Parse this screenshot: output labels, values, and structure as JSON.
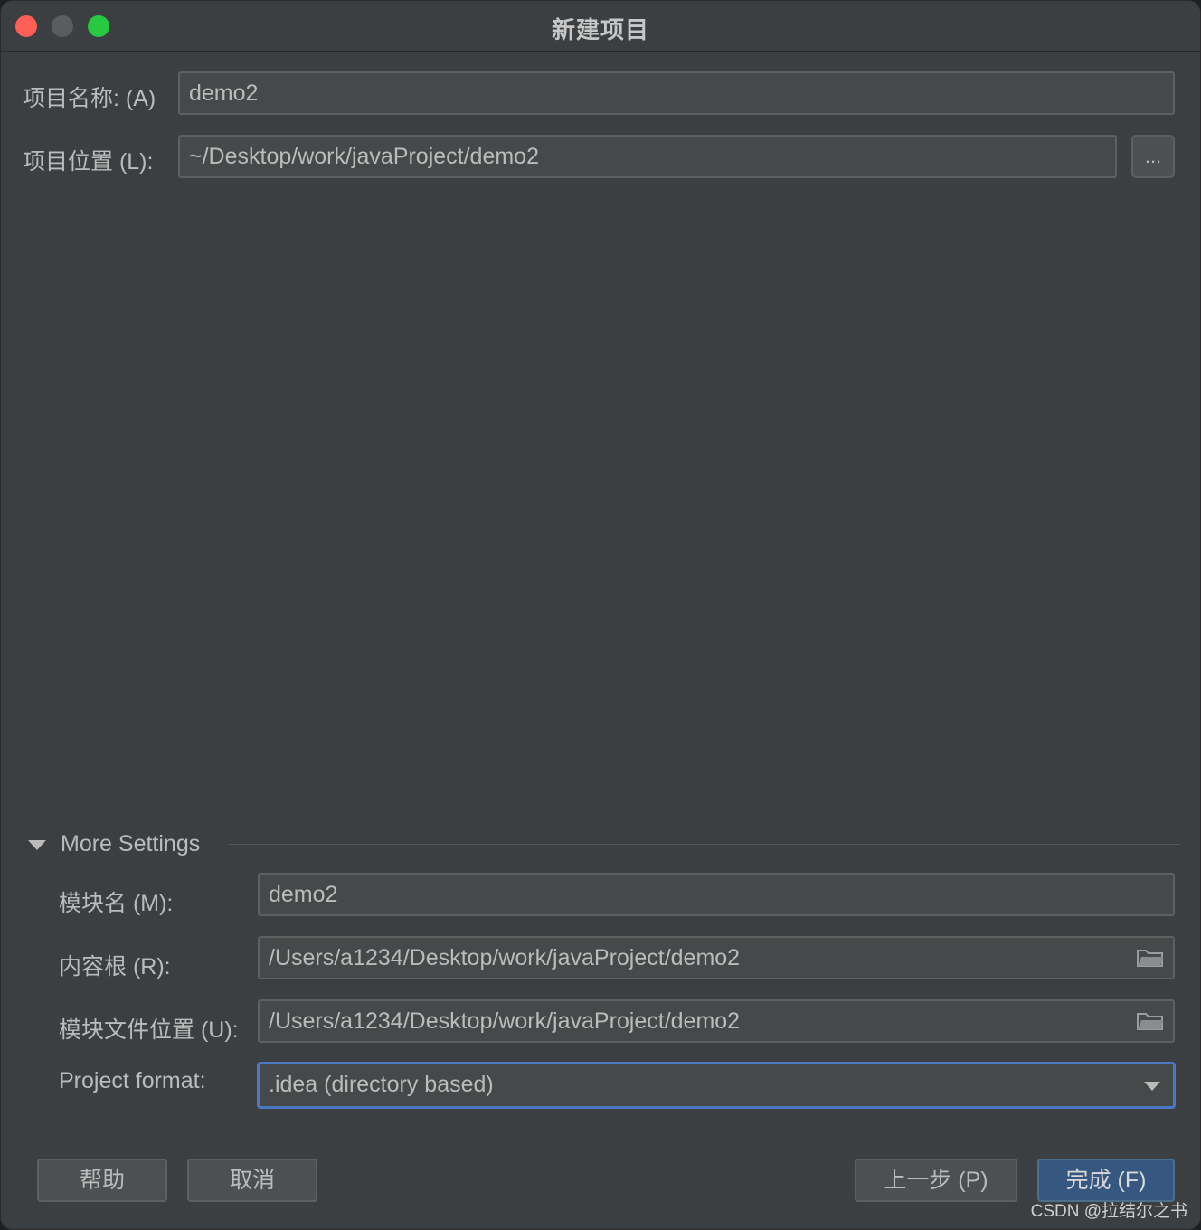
{
  "window": {
    "title": "新建项目"
  },
  "form": {
    "project_name_label": "项目名称: (A)",
    "project_name_value": "demo2",
    "project_location_label": "项目位置 (L):",
    "project_location_value": "~/Desktop/work/javaProject/demo2",
    "browse_label": "..."
  },
  "more_settings": {
    "title": "More Settings",
    "expanded": true,
    "module_name_label": "模块名 (M):",
    "module_name_value": "demo2",
    "content_root_label": "内容根 (R):",
    "content_root_value": "/Users/a1234/Desktop/work/javaProject/demo2",
    "module_file_label": "模块文件位置 (U):",
    "module_file_value": "/Users/a1234/Desktop/work/javaProject/demo2",
    "project_format_label": "Project format:",
    "project_format_value": ".idea (directory based)"
  },
  "buttons": {
    "help": "帮助",
    "cancel": "取消",
    "previous": "上一步 (P)",
    "finish": "完成 (F)"
  },
  "watermark": "CSDN @拉结尔之书",
  "colors": {
    "background": "#3c3f41",
    "field": "#45494a",
    "focus_border": "#4a78c2",
    "primary_button": "#365880",
    "close": "#ff5f57",
    "minimize": "#5b5c5e",
    "zoom": "#28c840"
  }
}
